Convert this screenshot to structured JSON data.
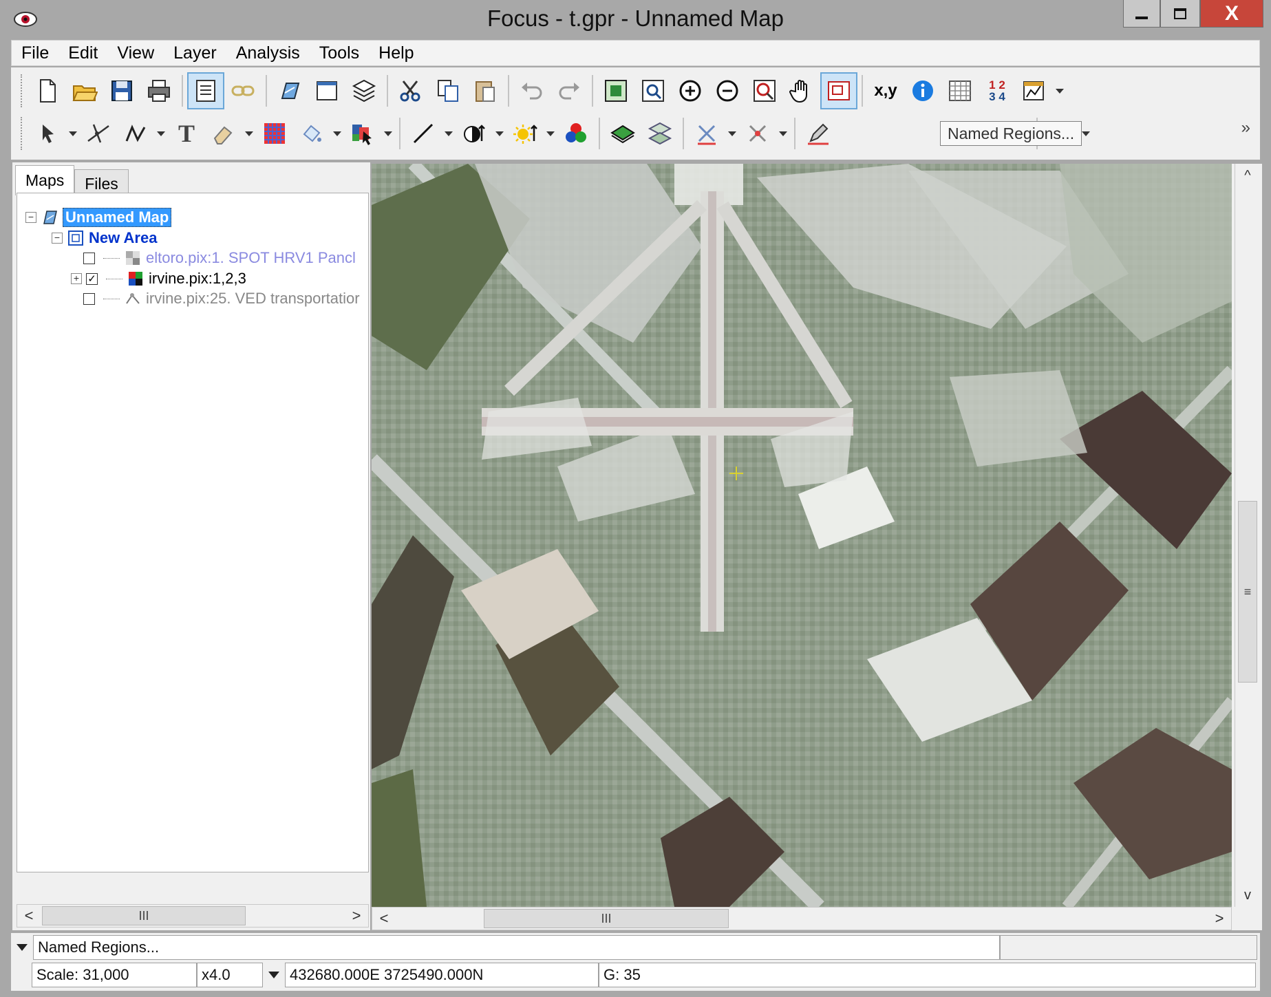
{
  "window": {
    "title": "Focus - t.gpr - Unnamed Map",
    "controls": {
      "minimize_icon": "minimize-icon",
      "maximize_icon": "maximize-icon",
      "close_label": "X"
    }
  },
  "menu": [
    "File",
    "Edit",
    "View",
    "Layer",
    "Analysis",
    "Tools",
    "Help"
  ],
  "toolbar": {
    "xy_label": "x,y",
    "numbers_label_top": "1 2",
    "numbers_label_bottom": "3 4",
    "text_tool": "T",
    "tooltip": "Named Regions...",
    "overflow": "»"
  },
  "tabs": {
    "maps": "Maps",
    "files": "Files"
  },
  "tree": {
    "map": "Unnamed Map",
    "area": "New Area",
    "layers": [
      {
        "label": "eltoro.pix:1. SPOT HRV1 Pancl",
        "checked": false,
        "style": "dim"
      },
      {
        "label": "irvine.pix:1,2,3",
        "checked": true,
        "style": "normal"
      },
      {
        "label": "irvine.pix:25. VED transportatior",
        "checked": false,
        "style": "gray"
      }
    ]
  },
  "scroll": {
    "left": "<",
    "right": ">",
    "thumb": "III",
    "up": "^",
    "down": "v",
    "vthumb": "≡"
  },
  "status": {
    "row1": "Named Regions...",
    "scale": "Scale: 31,000",
    "zoom": "x4.0",
    "coords": "432680.000E 3725490.000N",
    "value": "G: 35"
  },
  "colors": {
    "highlight": "#3399ff",
    "area": "#0033cc",
    "close": "#c7463a"
  }
}
